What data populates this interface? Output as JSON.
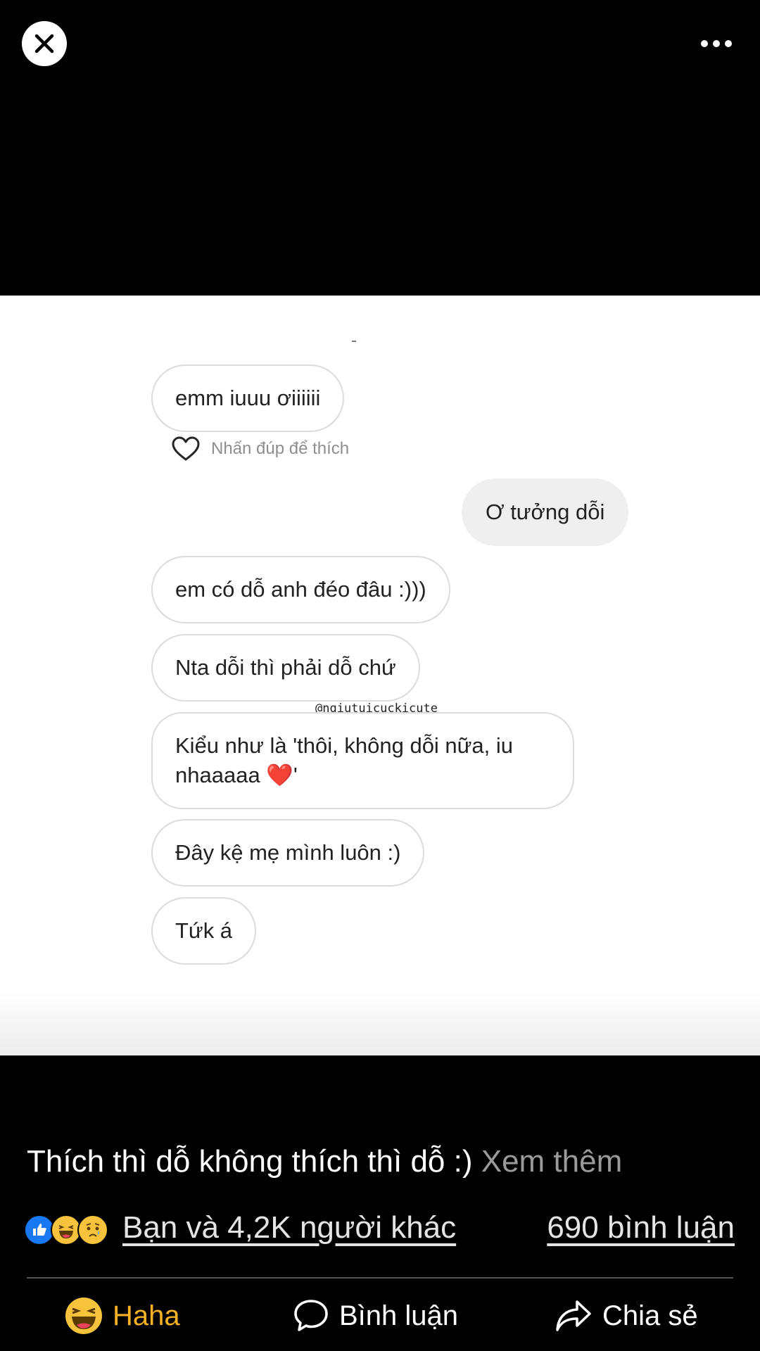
{
  "top_bar": {
    "close_icon": "close-icon",
    "more_icon": "more-horizontal-icon"
  },
  "chat": {
    "like_hint": "Nhấn đúp để thích",
    "watermark": "@ngiutuicuckicute",
    "messages": [
      {
        "text": "emm iuuu ơiiiiii",
        "sender": "other"
      },
      {
        "text": "Ơ tưởng dỗi",
        "sender": "me"
      },
      {
        "text": "em có dỗ anh đéo đâu :)))",
        "sender": "other"
      },
      {
        "text": "Nta dỗi thì phải dỗ chứ",
        "sender": "other"
      },
      {
        "text_before": "Kiểu như là 'thôi, không dỗi nữa, iu nhaaaaa ",
        "emoji": "❤️",
        "text_after": "'",
        "sender": "other"
      },
      {
        "text": "Đây kệ mẹ mình luôn :)",
        "sender": "other"
      },
      {
        "text": "Tứk á",
        "sender": "other"
      }
    ]
  },
  "post": {
    "caption": "Thích thì dỗ không thích thì dỗ :)",
    "see_more": "Xem thêm",
    "reactions_text": "Bạn và 4,2K người khác",
    "reaction_icons": [
      "like-icon",
      "haha-icon",
      "sad-icon"
    ],
    "comments_count": "690 bình luận"
  },
  "actions": {
    "haha_label": "Haha",
    "comment_label": "Bình luận",
    "share_label": "Chia sẻ"
  },
  "colors": {
    "haha": "#f7b125",
    "like_blue": "#1877f2",
    "background": "#000000"
  }
}
